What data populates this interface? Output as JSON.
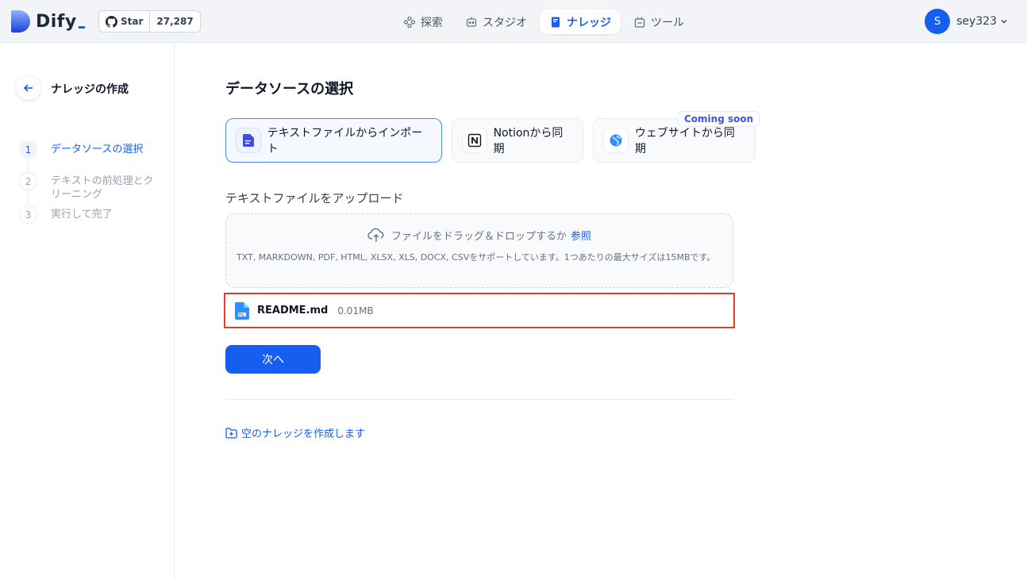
{
  "header": {
    "logo_text": "Dify",
    "github": {
      "star_label": "Star",
      "count": "27,287"
    },
    "nav": [
      {
        "label": "探索",
        "icon": "explore-icon"
      },
      {
        "label": "スタジオ",
        "icon": "studio-icon"
      },
      {
        "label": "ナレッジ",
        "icon": "knowledge-icon",
        "active": true
      },
      {
        "label": "ツール",
        "icon": "tools-icon"
      }
    ],
    "user": {
      "initial": "S",
      "name": "sey323"
    }
  },
  "sidebar": {
    "title": "ナレッジの作成",
    "steps": [
      {
        "num": "1",
        "label": "データソースの選択",
        "active": true
      },
      {
        "num": "2",
        "label": "テキストの前処理とクリーニング",
        "active": false
      },
      {
        "num": "3",
        "label": "実行して完了",
        "active": false
      }
    ]
  },
  "main": {
    "title": "データソースの選択",
    "sources": [
      {
        "label": "テキストファイルからインポート",
        "icon": "file-icon",
        "active": true
      },
      {
        "label": "Notionから同期",
        "icon": "notion-icon",
        "active": false
      },
      {
        "label": "ウェブサイトから同期",
        "icon": "website-icon",
        "active": false,
        "badge": "Coming soon"
      }
    ],
    "upload": {
      "title": "テキストファイルをアップロード",
      "drop_text": "ファイルをドラッグ＆ドロップするか",
      "browse_label": "参照",
      "support_text": "TXT, MARKDOWN, PDF, HTML, XLSX, XLS, DOCX, CSVをサポートしています。1つあたりの最大サイズは15MBです。"
    },
    "file": {
      "name": "README.md",
      "size": "0.01MB"
    },
    "next_label": "次へ",
    "empty_link": "空のナレッジを作成します"
  },
  "colors": {
    "accent": "#155eef",
    "highlight_border": "#e0402a"
  }
}
